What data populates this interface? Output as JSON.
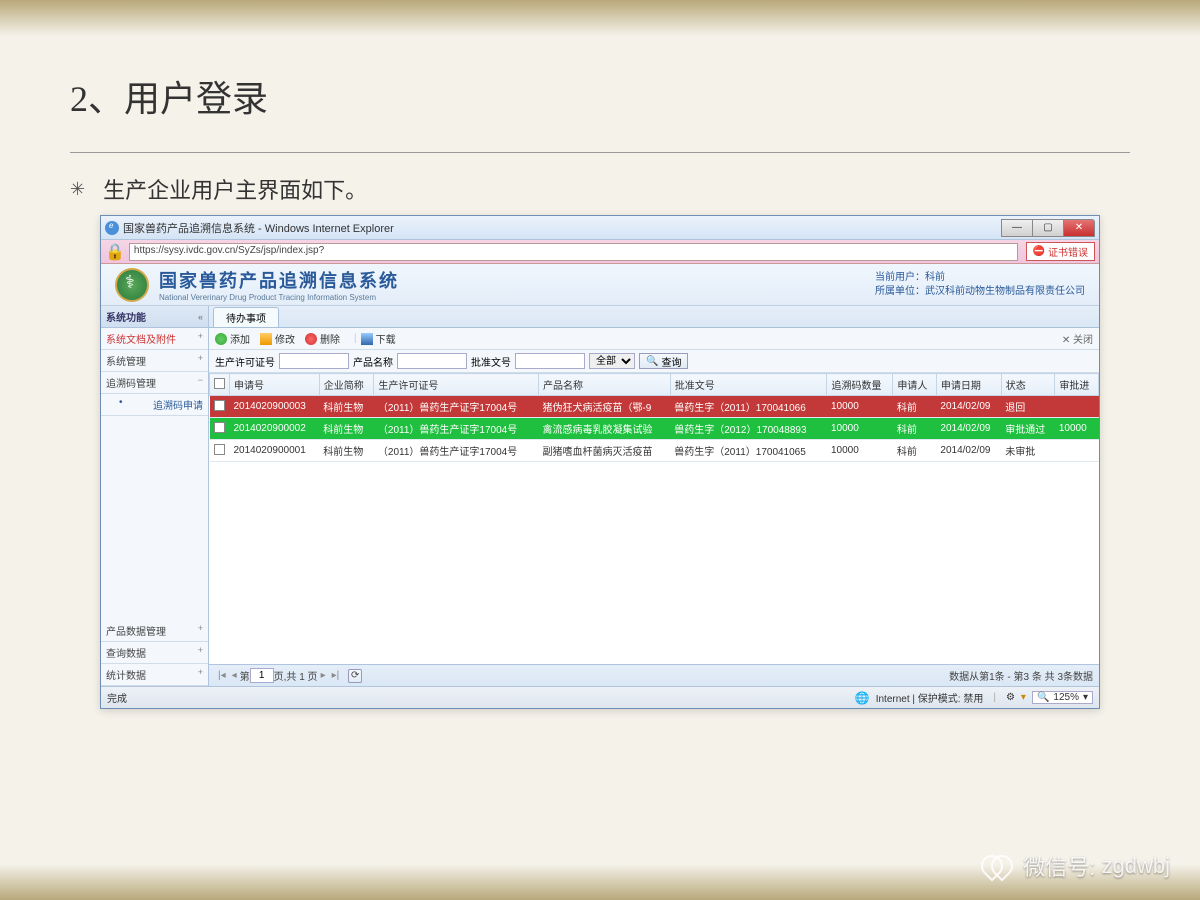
{
  "slide": {
    "title": "2、用户登录",
    "bullet": "生产企业用户主界面如下。"
  },
  "browser": {
    "title": "国家兽药产品追溯信息系统 - Windows Internet Explorer",
    "url": "https://sysy.ivdc.gov.cn/SyZs/jsp/index.jsp?",
    "cert_error": "证书错误",
    "status_done": "完成",
    "status_zone": "Internet | 保护模式: 禁用",
    "zoom": "125%"
  },
  "app": {
    "title_zh": "国家兽药产品追溯信息系统",
    "title_en": "National Vererinary Drug Product Tracing Information System",
    "cur_user_label": "当前用户：",
    "cur_user": "科前",
    "org_label": "所属单位：",
    "org": "武汉科前动物生物制品有限责任公司"
  },
  "sidebar": {
    "header": "系统功能",
    "items": [
      {
        "label": "系统文档及附件",
        "red": true,
        "exp": "+"
      },
      {
        "label": "系统管理",
        "red": false,
        "exp": "+"
      },
      {
        "label": "追溯码管理",
        "red": false,
        "exp": "−"
      }
    ],
    "sub": "追溯码申请",
    "bottom": [
      {
        "label": "产品数据管理",
        "exp": "+"
      },
      {
        "label": "查询数据",
        "exp": "+"
      },
      {
        "label": "统计数据",
        "exp": "+"
      }
    ]
  },
  "tabs": {
    "current": "待办事项"
  },
  "toolbar": {
    "add": "添加",
    "edit": "修改",
    "del": "删除",
    "download": "下载",
    "close": "关闭"
  },
  "filter": {
    "f1_label": "生产许可证号",
    "f2_label": "产品名称",
    "f3_label": "批准文号",
    "select": "全部",
    "search": "查询"
  },
  "grid": {
    "cols": [
      "",
      "申请号",
      "企业简称",
      "生产许可证号",
      "产品名称",
      "批准文号",
      "追溯码数量",
      "申请人",
      "申请日期",
      "状态",
      "审批进"
    ],
    "rows": [
      {
        "cls": "red",
        "c": [
          "2014020900003",
          "科前生物",
          "（2011）兽药生产证字17004号",
          "猪伪狂犬病活疫苗（鄂-9",
          "兽药生字（2011）170041066",
          "10000",
          "科前",
          "2014/02/09",
          "退回",
          ""
        ]
      },
      {
        "cls": "green",
        "c": [
          "2014020900002",
          "科前生物",
          "（2011）兽药生产证字17004号",
          "禽流感病毒乳胶凝集试验",
          "兽药生字（2012）170048893",
          "10000",
          "科前",
          "2014/02/09",
          "审批通过",
          "10000"
        ]
      },
      {
        "cls": "normal",
        "c": [
          "2014020900001",
          "科前生物",
          "（2011）兽药生产证字17004号",
          "副猪嗜血杆菌病灭活疫苗",
          "兽药生字（2011）170041065",
          "10000",
          "科前",
          "2014/02/09",
          "未审批",
          ""
        ]
      }
    ]
  },
  "pager": {
    "page_label1": "第",
    "page": "1",
    "page_label2": "页,共 1 页",
    "info": "数据从第1条 - 第3 条 共 3条数据"
  },
  "watermark": {
    "label": "微信号:",
    "id": "zgdwbj"
  }
}
